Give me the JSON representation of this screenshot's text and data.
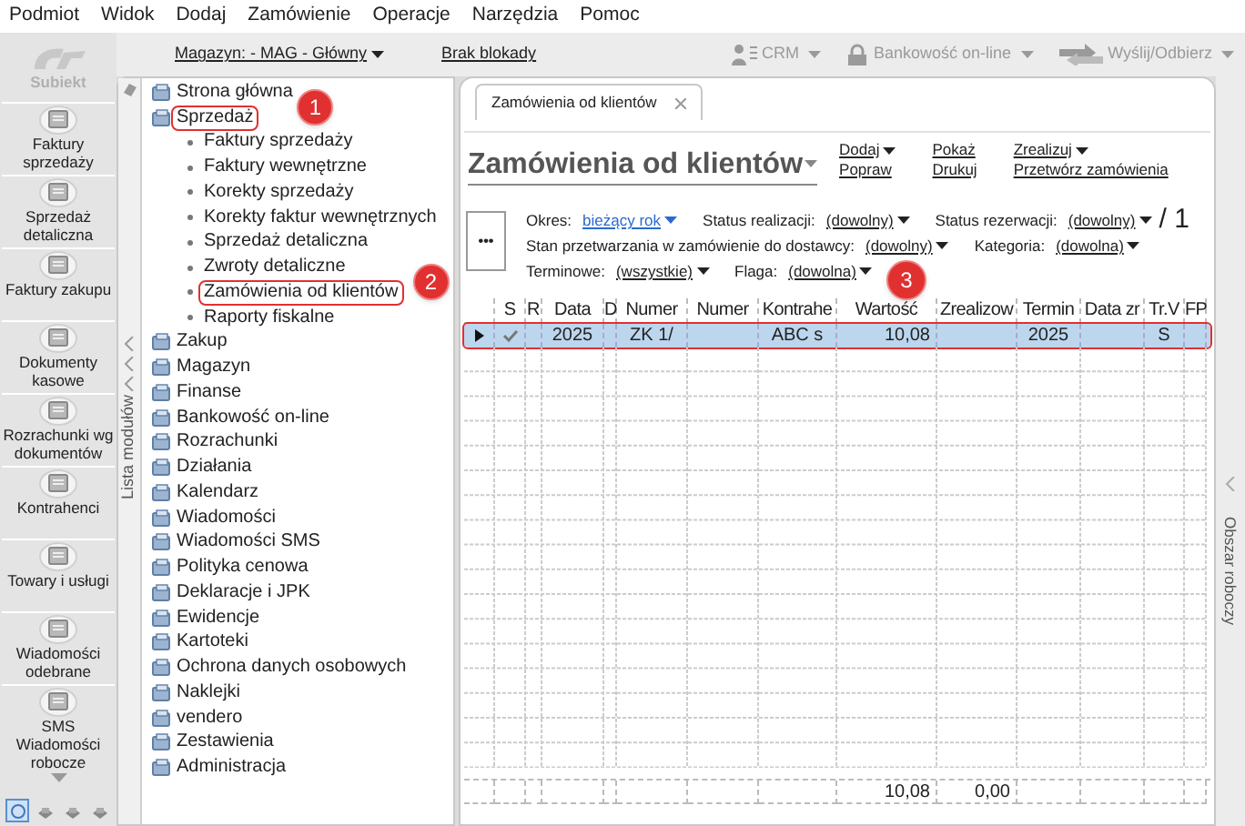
{
  "menu": [
    "Podmiot",
    "Widok",
    "Dodaj",
    "Zamówienie",
    "Operacje",
    "Narzędzia",
    "Pomoc"
  ],
  "sidebar": {
    "logo": "Subiekt",
    "items": [
      {
        "label": "Faktury sprzedaży"
      },
      {
        "label": "Sprzedaż detaliczna"
      },
      {
        "label": "Faktury zakupu"
      },
      {
        "label": "Dokumenty kasowe"
      },
      {
        "label": "Rozrachunki wg dokumentów"
      },
      {
        "label": "Kontrahenci"
      },
      {
        "label": "Towary i usługi"
      },
      {
        "label": "Wiadomości odebrane"
      },
      {
        "label": "SMS Wiadomości robocze"
      }
    ],
    "bottom_buttons": [
      {
        "selected": true
      },
      {
        "selected": false
      },
      {
        "selected": false
      },
      {
        "selected": false
      }
    ]
  },
  "toolbar": {
    "warehouse": "Magazyn: - MAG - Główny",
    "lock_status": "Brak blokady",
    "buttons": [
      {
        "label": "CRM",
        "kind": "crm",
        "disabled": true
      },
      {
        "label": "Bankowość on-line",
        "kind": "bank",
        "disabled": true
      },
      {
        "label": "Wyślij/Odbierz",
        "kind": "sync",
        "disabled": true
      }
    ]
  },
  "module_list": {
    "title": "Lista modułów",
    "items": [
      {
        "label": "Strona główna"
      },
      {
        "label": "Sprzedaż",
        "expanded": true,
        "highlighted": true,
        "callout": "1",
        "children": [
          {
            "label": "Faktury sprzedaży"
          },
          {
            "label": "Faktury wewnętrzne"
          },
          {
            "label": "Korekty sprzedaży"
          },
          {
            "label": "Korekty faktur wewnętrznych"
          },
          {
            "label": "Sprzedaż detaliczna"
          },
          {
            "label": "Zwroty detaliczne"
          },
          {
            "label": "Zamówienia od klientów",
            "highlighted": true,
            "callout": "2"
          },
          {
            "label": "Raporty fiskalne"
          }
        ]
      },
      {
        "label": "Zakup"
      },
      {
        "label": "Magazyn"
      },
      {
        "label": "Finanse"
      },
      {
        "label": "Bankowość on-line"
      },
      {
        "label": "Rozrachunki"
      },
      {
        "label": "Działania"
      },
      {
        "label": "Kalendarz"
      },
      {
        "label": "Wiadomości"
      },
      {
        "label": "Wiadomości SMS"
      },
      {
        "label": "Polityka cenowa"
      },
      {
        "label": "Deklaracje i JPK"
      },
      {
        "label": "Ewidencje"
      },
      {
        "label": "Kartoteki"
      },
      {
        "label": "Ochrona danych osobowych"
      },
      {
        "label": "Naklejki"
      },
      {
        "label": "vendero"
      },
      {
        "label": "Zestawienia"
      },
      {
        "label": "Administracja"
      }
    ]
  },
  "tab": {
    "label": "Zamówienia od klientów",
    "selected": true
  },
  "view": {
    "title": "Zamówienia od klientów",
    "actions": [
      [
        {
          "label": "Dodaj",
          "has_menu": true
        },
        {
          "label": "Popraw",
          "has_menu": false
        }
      ],
      [
        {
          "label": "Pokaż",
          "has_menu": false
        },
        {
          "label": "Drukuj",
          "has_menu": false
        }
      ],
      [
        {
          "label": "Zrealizuj",
          "has_menu": true
        },
        {
          "label": "Przetwórz zamówienia",
          "has_menu": false
        }
      ]
    ],
    "more_button": "•••",
    "filters": [
      [
        {
          "label": "Okres:",
          "value": "bieżący rok",
          "kind": "period"
        },
        {
          "label": "Status realizacji:",
          "value": "(dowolny)",
          "kind": "plain"
        },
        {
          "label": "Status rezerwacji:",
          "value": "(dowolny)",
          "kind": "plain"
        }
      ],
      [
        {
          "label": "Stan przetwarzania w zamówienie do dostawcy:",
          "value": "(dowolny)",
          "kind": "plain"
        },
        {
          "label": "Kategoria:",
          "value": "(dowolna)",
          "kind": "plain"
        }
      ],
      [
        {
          "label": "Terminowe:",
          "value": "(wszystkie)",
          "kind": "plain"
        },
        {
          "label": "Flaga:",
          "value": "(dowolna)",
          "kind": "plain"
        }
      ]
    ],
    "page_count": "/ 1"
  },
  "table": {
    "callout": "3",
    "columns": [
      {
        "label": "S"
      },
      {
        "label": "R"
      },
      {
        "label": "Data"
      },
      {
        "label": "D"
      },
      {
        "label": "Numer"
      },
      {
        "label": "Numer"
      },
      {
        "label": "Kontrahe"
      },
      {
        "label": "Wartość",
        "total": "10,08"
      },
      {
        "label": "Zrealizow",
        "total": "0,00"
      },
      {
        "label": "Termin"
      },
      {
        "label": "Data zr"
      },
      {
        "label": "Tr.V"
      },
      {
        "label": "FP"
      }
    ],
    "rows": [
      {
        "selected": true,
        "highlighted": true,
        "checked": true,
        "cells": [
          null,
          null,
          "2025",
          null,
          "ZK 1/",
          null,
          "ABC s",
          "10,08",
          null,
          "2025",
          null,
          "S",
          null
        ]
      }
    ]
  },
  "side_panel": {
    "title": "Obszar roboczy"
  }
}
